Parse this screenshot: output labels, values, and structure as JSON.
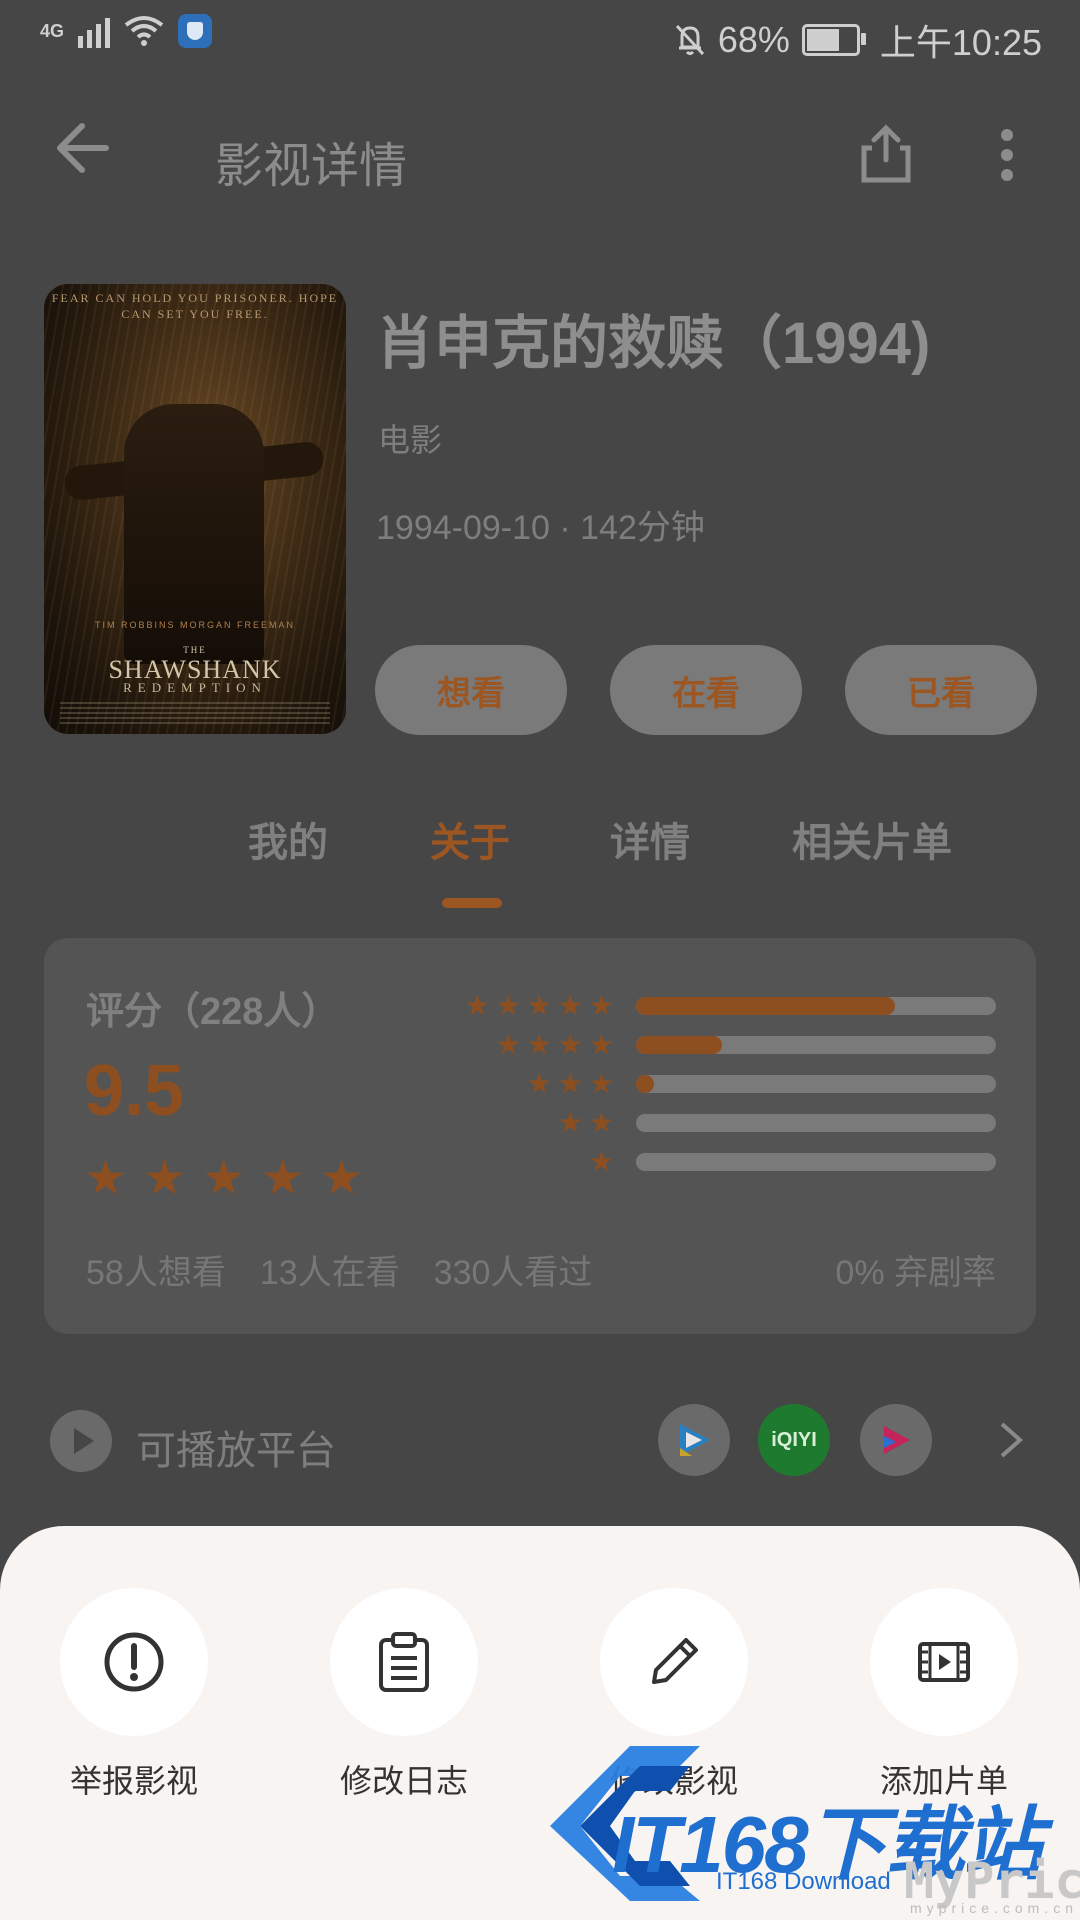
{
  "status_bar": {
    "network": "4G",
    "battery": "68%",
    "time": "上午10:25",
    "icons": [
      "signal-icon",
      "wifi-icon",
      "shield-app-icon",
      "mute-bell-icon",
      "battery-icon"
    ]
  },
  "app_bar": {
    "title": "影视详情",
    "icons": [
      "back-arrow-icon",
      "share-icon",
      "more-vertical-icon"
    ]
  },
  "movie": {
    "title": "肖申克的救赎（1994)",
    "type": "电影",
    "meta": "1994-09-10 · 142分钟",
    "poster": {
      "tagline": "FEAR CAN HOLD YOU PRISONER. HOPE CAN SET YOU FREE.",
      "names": "TIM ROBBINS   MORGAN FREEMAN",
      "title_small": "THE",
      "title": "SHAWSHANK",
      "subtitle": "REDEMPTION"
    }
  },
  "status_buttons": [
    "想看",
    "在看",
    "已看"
  ],
  "tabs": [
    {
      "label": "我的",
      "active": false
    },
    {
      "label": "关于",
      "active": true
    },
    {
      "label": "详情",
      "active": false
    },
    {
      "label": "相关片单",
      "active": false
    }
  ],
  "rating": {
    "label": "评分（228人）",
    "score": "9.5",
    "stars": 5,
    "distribution": [
      {
        "stars": 5,
        "fraction": 0.72
      },
      {
        "stars": 4,
        "fraction": 0.24
      },
      {
        "stars": 3,
        "fraction": 0.05
      },
      {
        "stars": 2,
        "fraction": 0.0
      },
      {
        "stars": 1,
        "fraction": 0.0
      }
    ],
    "counts": [
      "58人想看",
      "13人在看",
      "330人看过"
    ],
    "drop_rate": "0% 弃剧率"
  },
  "platforms": {
    "label": "可播放平台",
    "items": [
      {
        "name": "tencent-video-icon",
        "color": "#6a6a6a"
      },
      {
        "name": "iqiyi-icon",
        "text": "iQIYI",
        "color": "#1e7a2e"
      },
      {
        "name": "youku-icon",
        "color": "#6a6a6a"
      }
    ]
  },
  "actions": [
    {
      "label": "举报影视",
      "icon": "report-exclamation-icon"
    },
    {
      "label": "修改日志",
      "icon": "clipboard-icon"
    },
    {
      "label": "修改影视",
      "icon": "pencil-icon"
    },
    {
      "label": "添加片单",
      "icon": "film-icon"
    }
  ],
  "watermark": {
    "brand": "IT168下载站",
    "sub": "IT168 Download",
    "my": "MyPrice",
    "url": "myprice.com.cn"
  },
  "colors": {
    "accent": "#9c5622",
    "overlay_bg": "#464646",
    "sheet_bg": "#f8f4f2",
    "watermark_blue": "#1f6fd1"
  }
}
